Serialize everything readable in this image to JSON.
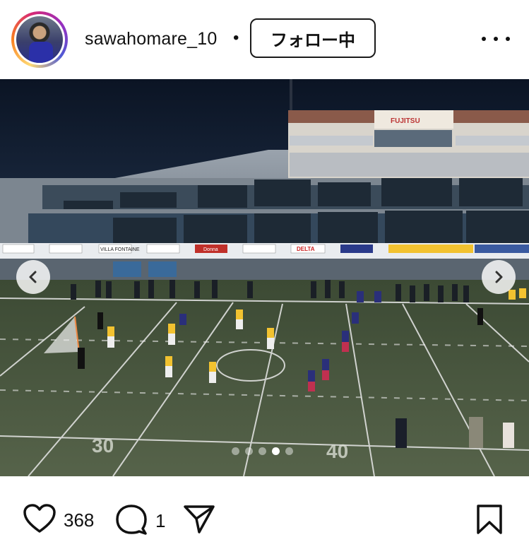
{
  "post": {
    "username": "sawahomare_10",
    "separator": "•",
    "follow_label": "フォロー中",
    "more_icon": "more-horizontal-icon"
  },
  "media": {
    "carousel_dots": 5,
    "active_dot_index": 3,
    "prev_icon": "chevron-left-icon",
    "next_icon": "chevron-right-icon",
    "scoreboard_brand": "FUJITSU",
    "banner_texts": [
      "DELTA",
      "VILLA FONTAINE",
      "Donna"
    ],
    "field_numbers": [
      "30",
      "40"
    ]
  },
  "actions": {
    "like_count": "368",
    "comment_count": "1",
    "like_icon": "heart-icon",
    "comment_icon": "comment-icon",
    "share_icon": "send-icon",
    "save_icon": "bookmark-icon"
  },
  "colors": {
    "field": "#4a5a3a",
    "sky": "#0f1a2e",
    "accent_yellow": "#f2c230",
    "accent_navy": "#2a2f7a"
  }
}
